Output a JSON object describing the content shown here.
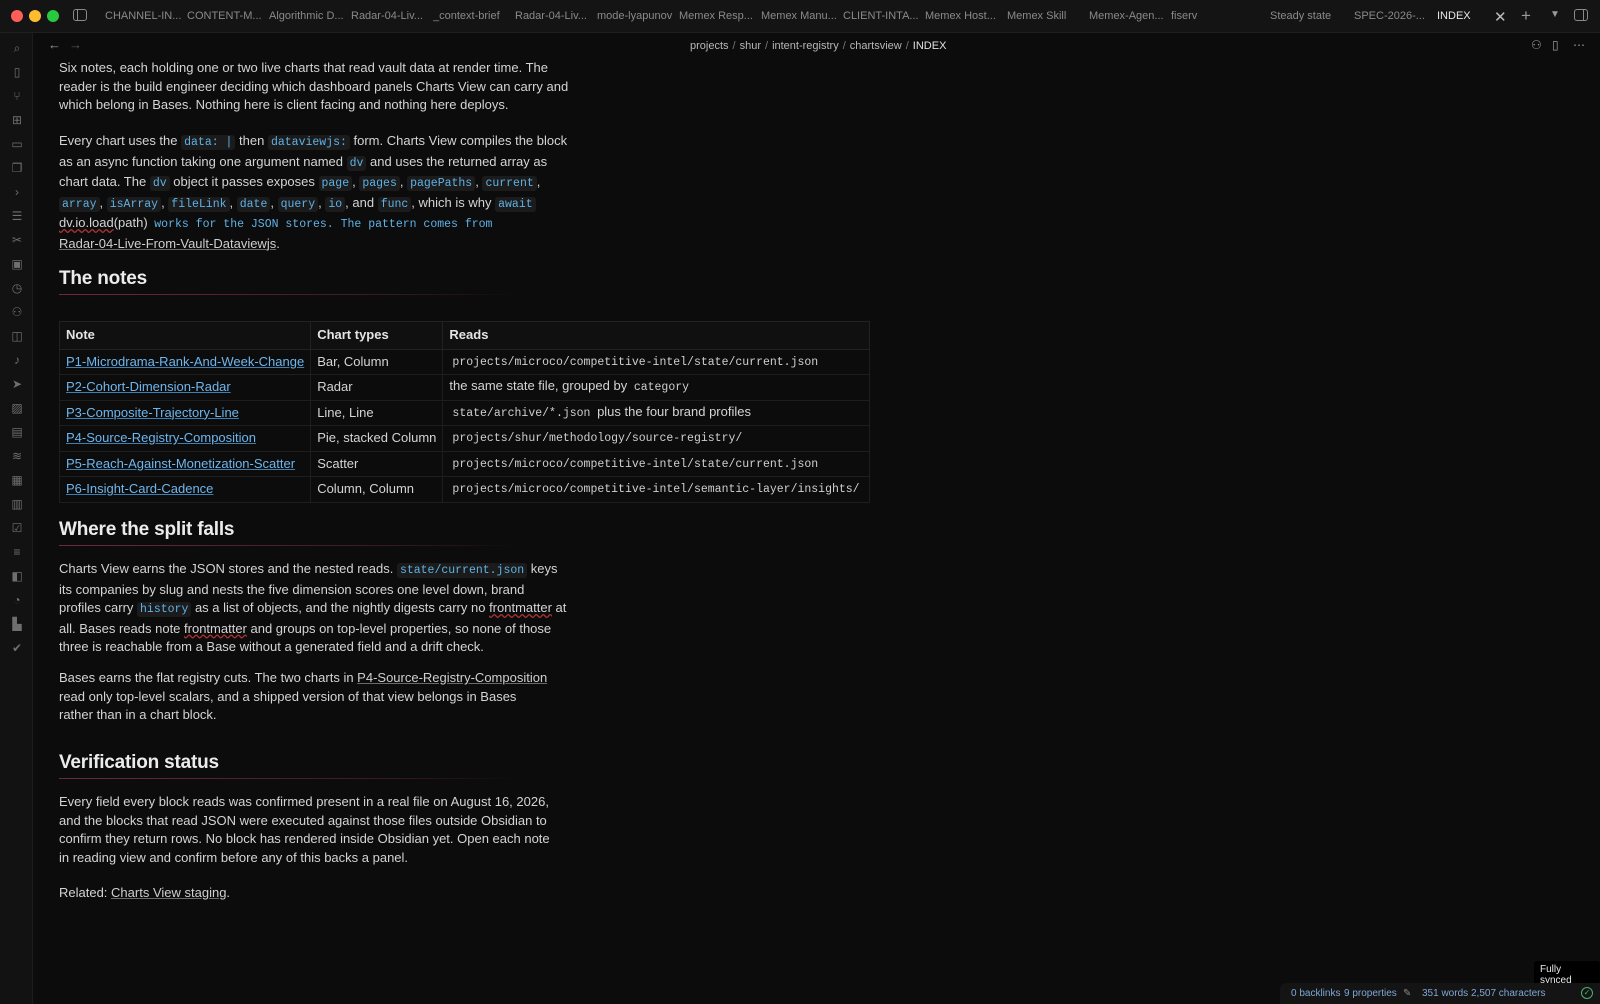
{
  "tabs": [
    "CHANNEL-IN...",
    "CONTENT-M...",
    "Algorithmic D...",
    "Radar-04-Liv...",
    "_context-brief",
    "Radar-04-Liv...",
    "mode-lyapunov",
    "Memex Resp...",
    "Memex Manu...",
    "CLIENT-INTA...",
    "Memex Host...",
    "Memex Skill",
    "Memex-Agen...",
    "fiserv",
    "Steady state",
    "SPEC-2026-...",
    "INDEX"
  ],
  "breadcrumb": [
    "projects",
    "shur",
    "intent-registry",
    "chartsview",
    "INDEX"
  ],
  "intro": {
    "p1": "Six notes, each holding one or two live charts that read vault data at render time. The reader is the build engineer deciding which dashboard panels Charts View can carry and which belong in Bases. Nothing here is client facing and nothing here deploys.",
    "p2_a": "Every chart uses the ",
    "p2_code1": "data: |",
    "p2_b": " then ",
    "p2_code2": "dataviewjs:",
    "p2_c": " form. Charts View compiles the block as an async function taking one argument named ",
    "p2_code3": "dv",
    "p2_d": " and uses the returned array as chart data. The ",
    "p2_code4": "dv",
    "p2_e": " object it passes exposes ",
    "p2_code_page": "page",
    "p2_code_pages": "pages",
    "p2_code_pagePaths": "pagePaths",
    "p2_code_current": "current",
    "p2_code_array": "array",
    "p2_code_isArray": "isArray",
    "p2_code_fileLink": "fileLink",
    "p2_code_date": "date",
    "p2_code_query": "query",
    "p2_code_io": "io",
    "p2_and": ", and ",
    "p2_code_func": "func",
    "p2_f": ", which is why ",
    "p2_code_await": "await",
    "p2_g_load": "dv.io.load",
    "p2_g_path": "(path)",
    "p2_code_tail": "works for the JSON stores. The pattern comes from",
    "p2_link": "Radar-04-Live-From-Vault-Dataviewjs",
    "p2_end": "."
  },
  "notes_section": {
    "heading": "The notes",
    "headers": [
      "Note",
      "Chart types",
      "Reads"
    ],
    "rows": [
      {
        "note": "P1-Microdrama-Rank-And-Week-Change",
        "types": "Bar, Column",
        "reads_code": "projects/microco/competitive-intel/state/current.json",
        "reads_text": ""
      },
      {
        "note": "P2-Cohort-Dimension-Radar",
        "types": "Radar",
        "reads_pre": "the same state file, grouped by ",
        "reads_code": "category",
        "reads_text": ""
      },
      {
        "note": "P3-Composite-Trajectory-Line",
        "types": "Line, Line",
        "reads_code": "state/archive/*.json",
        "reads_text": " plus the four brand profiles"
      },
      {
        "note": "P4-Source-Registry-Composition",
        "types": "Pie, stacked Column",
        "reads_code": "projects/shur/methodology/source-registry/",
        "reads_text": ""
      },
      {
        "note": "P5-Reach-Against-Monetization-Scatter",
        "types": "Scatter",
        "reads_code": "projects/microco/competitive-intel/state/current.json",
        "reads_text": ""
      },
      {
        "note": "P6-Insight-Card-Cadence",
        "types": "Column, Column",
        "reads_code": "projects/microco/competitive-intel/semantic-layer/insights/",
        "reads_text": ""
      }
    ]
  },
  "split_section": {
    "heading": "Where the split falls",
    "p1_a": "Charts View earns the JSON stores and the nested reads. ",
    "p1_code": "state/current.json",
    "p1_b": " keys its companies by slug and nests the five dimension scores one level down, brand profiles carry ",
    "p1_code2": "history",
    "p1_c": " as a list of objects, and the nightly digests carry no ",
    "p1_fm1": "frontmatter",
    "p1_d": " at all. Bases reads note ",
    "p1_fm2": "frontmatter",
    "p1_e": " and groups on top-level properties, so none of those three is reachable from a Base without a generated field and a drift check.",
    "p2_a": "Bases earns the flat registry cuts. The two charts in ",
    "p2_link": "P4-Source-Registry-Composition",
    "p2_b": " read only top-level scalars, and a shipped version of that view belongs in Bases rather than in a chart block."
  },
  "verify_section": {
    "heading": "Verification status",
    "p1": "Every field every block reads was confirmed present in a real file on August 16, 2026, and the blocks that read JSON were executed against those files outside Obsidian to confirm they return rows. No block has rendered inside Obsidian yet. Open each note in reading view and confirm before any of this backs a panel.",
    "related_label": "Related: ",
    "related_link": "Charts View staging",
    "related_end": "."
  },
  "status": {
    "tooltip": "Fully synced",
    "backlinks": "0 backlinks",
    "properties": "9 properties",
    "words": "351 words",
    "characters": "2,507 characters"
  }
}
